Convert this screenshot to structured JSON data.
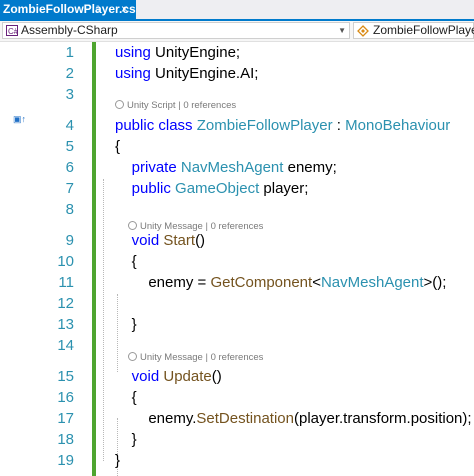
{
  "tab": {
    "title": "ZombieFollowPlayer.cs",
    "pin": "⇩",
    "close": "×"
  },
  "navbar": {
    "left_label": "Assembly-CSharp",
    "right_label": "ZombieFollowPlayer"
  },
  "editor": {
    "line_numbers": [
      "1",
      "2",
      "3",
      "4",
      "5",
      "6",
      "7",
      "8",
      "9",
      "10",
      "11",
      "12",
      "13",
      "14",
      "15",
      "16",
      "17",
      "18",
      "19"
    ],
    "codelens": [
      {
        "text": "Unity Script | 0 references"
      },
      {
        "text": "Unity Message | 0 references"
      },
      {
        "text": "Unity Message | 0 references"
      }
    ],
    "lines": [
      [
        [
          "kw",
          "using"
        ],
        [
          "pl",
          " UnityEngine;"
        ]
      ],
      [
        [
          "kw",
          "using"
        ],
        [
          "pl",
          " UnityEngine.AI;"
        ]
      ],
      [],
      [
        [
          "kw",
          "public"
        ],
        [
          "pl",
          " "
        ],
        [
          "kw",
          "class"
        ],
        [
          "pl",
          " "
        ],
        [
          "ty",
          "ZombieFollowPlayer"
        ],
        [
          "pl",
          " : "
        ],
        [
          "ty",
          "MonoBehaviour"
        ]
      ],
      [
        [
          "pl",
          "{"
        ]
      ],
      [
        [
          "pl",
          "    "
        ],
        [
          "kw",
          "private"
        ],
        [
          "pl",
          " "
        ],
        [
          "ty",
          "NavMeshAgent"
        ],
        [
          "pl",
          " enemy;"
        ]
      ],
      [
        [
          "pl",
          "    "
        ],
        [
          "kw",
          "public"
        ],
        [
          "pl",
          " "
        ],
        [
          "ty",
          "GameObject"
        ],
        [
          "pl",
          " player;"
        ]
      ],
      [],
      [
        [
          "pl",
          "    "
        ],
        [
          "kw",
          "void"
        ],
        [
          "pl",
          " "
        ],
        [
          "fn",
          "Start"
        ],
        [
          "pl",
          "()"
        ]
      ],
      [
        [
          "pl",
          "    {"
        ]
      ],
      [
        [
          "pl",
          "        enemy = "
        ],
        [
          "fn",
          "GetComponent"
        ],
        [
          "pl",
          "<"
        ],
        [
          "ty",
          "NavMeshAgent"
        ],
        [
          "pl",
          ">();"
        ]
      ],
      [],
      [
        [
          "pl",
          "    }"
        ]
      ],
      [],
      [
        [
          "pl",
          "    "
        ],
        [
          "kw",
          "void"
        ],
        [
          "pl",
          " "
        ],
        [
          "fn",
          "Update"
        ],
        [
          "pl",
          "()"
        ]
      ],
      [
        [
          "pl",
          "    {"
        ]
      ],
      [
        [
          "pl",
          "        enemy."
        ],
        [
          "fn",
          "SetDestination"
        ],
        [
          "pl",
          "(player.transform.position);"
        ]
      ],
      [
        [
          "pl",
          "    }"
        ]
      ],
      [
        [
          "pl",
          "}"
        ]
      ]
    ]
  },
  "colors": {
    "keyword": "#0000ff",
    "type": "#2b91af",
    "method": "#74531f",
    "line_number": "#2b91af",
    "tab_active": "#007acc",
    "change_bar": "#4ea52f"
  }
}
